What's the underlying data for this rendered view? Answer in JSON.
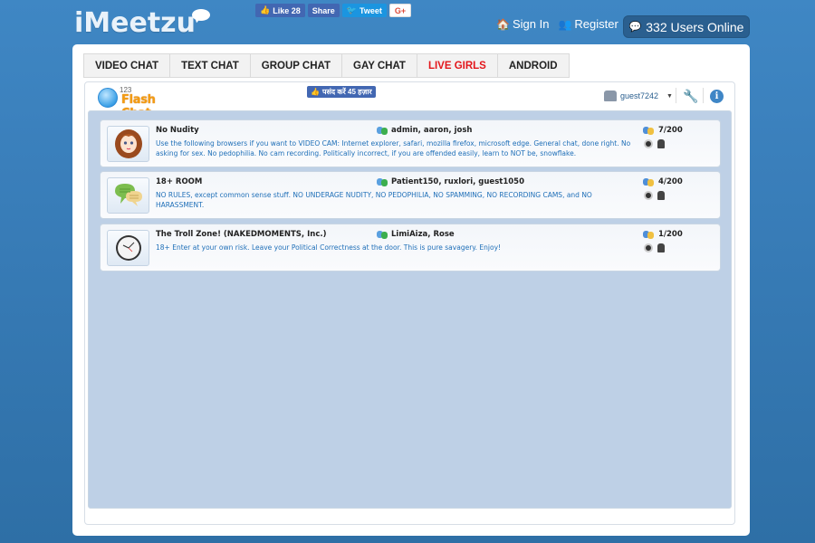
{
  "header": {
    "logo": "iMeetzu",
    "social": {
      "like_label": "Like 28",
      "share_label": "Share",
      "tweet_label": "Tweet",
      "gplus_label": "G+"
    },
    "sign_in": "Sign In",
    "register": "Register",
    "users_online": "332 Users Online"
  },
  "tabs": [
    {
      "label": "VIDEO CHAT"
    },
    {
      "label": "TEXT CHAT"
    },
    {
      "label": "GROUP CHAT"
    },
    {
      "label": "GAY CHAT"
    },
    {
      "label": "LIVE GIRLS",
      "color": "#e3161b"
    },
    {
      "label": "ANDROID"
    }
  ],
  "chat": {
    "logo_small": "123",
    "logo_text": "Flash Chat",
    "fb_like": "पसंद करें 45 हज़ार",
    "username": "guest7242"
  },
  "rooms": [
    {
      "name": "No Nudity",
      "users": "admin, aaron, josh",
      "count": "7/200",
      "description": "Use the following browsers if you want to VIDEO CAM: Internet explorer, safari, mozilla firefox, microsoft edge. General chat, done right. No asking for sex. No pedophilia. No cam recording. Politically incorrect, if you are offended easily, learn to NOT be, snowflake.",
      "icon": "girl-avatar-icon"
    },
    {
      "name": "18+ ROOM",
      "users": "Patient150, ruxlori, guest1050",
      "count": "4/200",
      "description": "NO RULES, except common sense stuff. NO UNDERAGE NUDITY, NO PEDOPHILIA, NO SPAMMING, NO RECORDING CAMS, and NO HARASSMENT.",
      "icon": "speech-bubbles-icon"
    },
    {
      "name": "The Troll Zone! (NAKEDMOMENTS, Inc.)",
      "users": "LimiAiza, Rose",
      "count": "1/200",
      "description": "18+ Enter at your own risk. Leave your Political Correctness at the door. This is pure savagery. Enjoy!",
      "icon": "clock-icon"
    }
  ]
}
